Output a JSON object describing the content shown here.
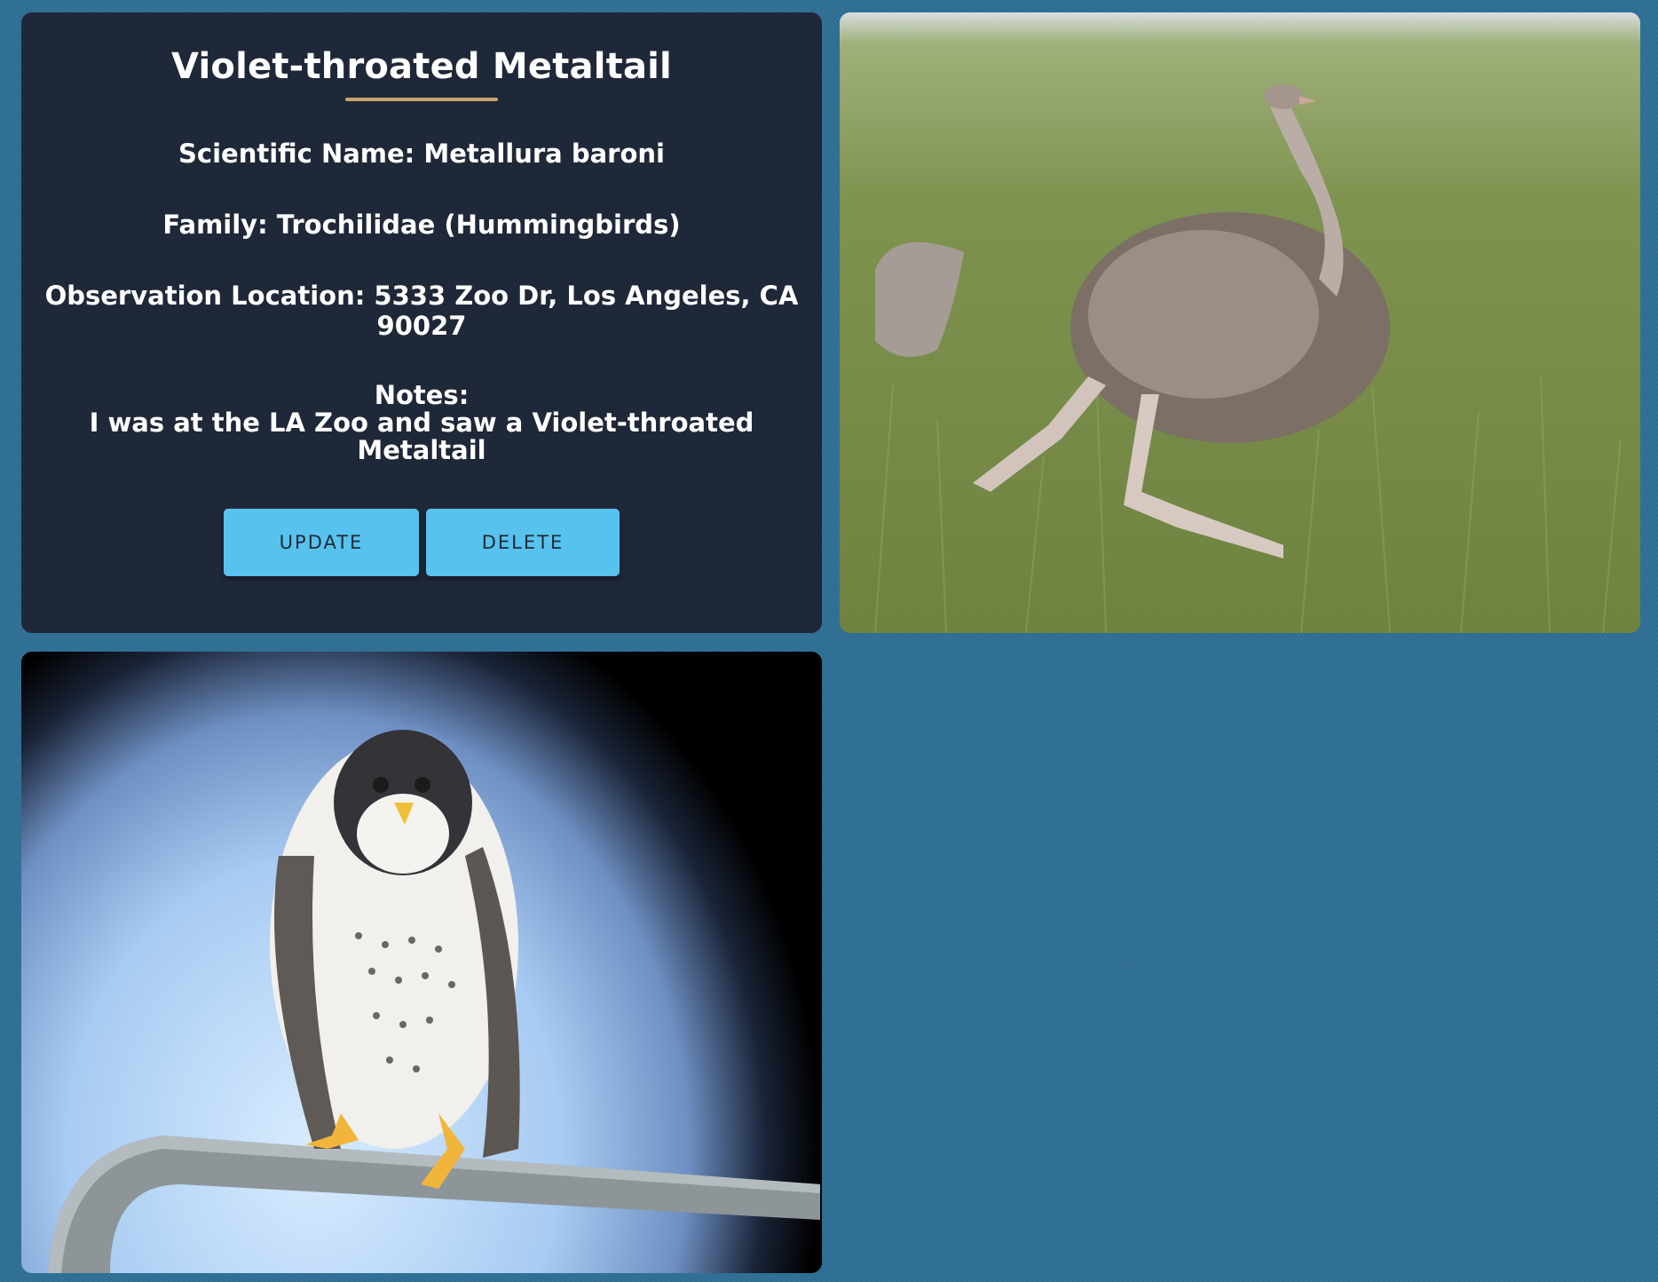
{
  "observation": {
    "title": "Violet-throated Metaltail",
    "scientific_name": "Scientific Name: Metallura baroni",
    "family": "Family: Trochilidae (Hummingbirds)",
    "location": "Observation Location: 5333 Zoo Dr, Los Angeles, CA 90027",
    "notes_label": "Notes:",
    "notes_text": "I was at the LA Zoo and saw a Violet-throated Metaltail",
    "update_label": "UPDATE",
    "delete_label": "DELETE"
  },
  "colors": {
    "page_background": "#2f7096",
    "card_background": "#1f2838",
    "accent_underline": "#c9a46a",
    "button": "#58c2ee"
  },
  "images": [
    {
      "subject": "ostrich"
    },
    {
      "subject": "peregrine falcon"
    }
  ]
}
